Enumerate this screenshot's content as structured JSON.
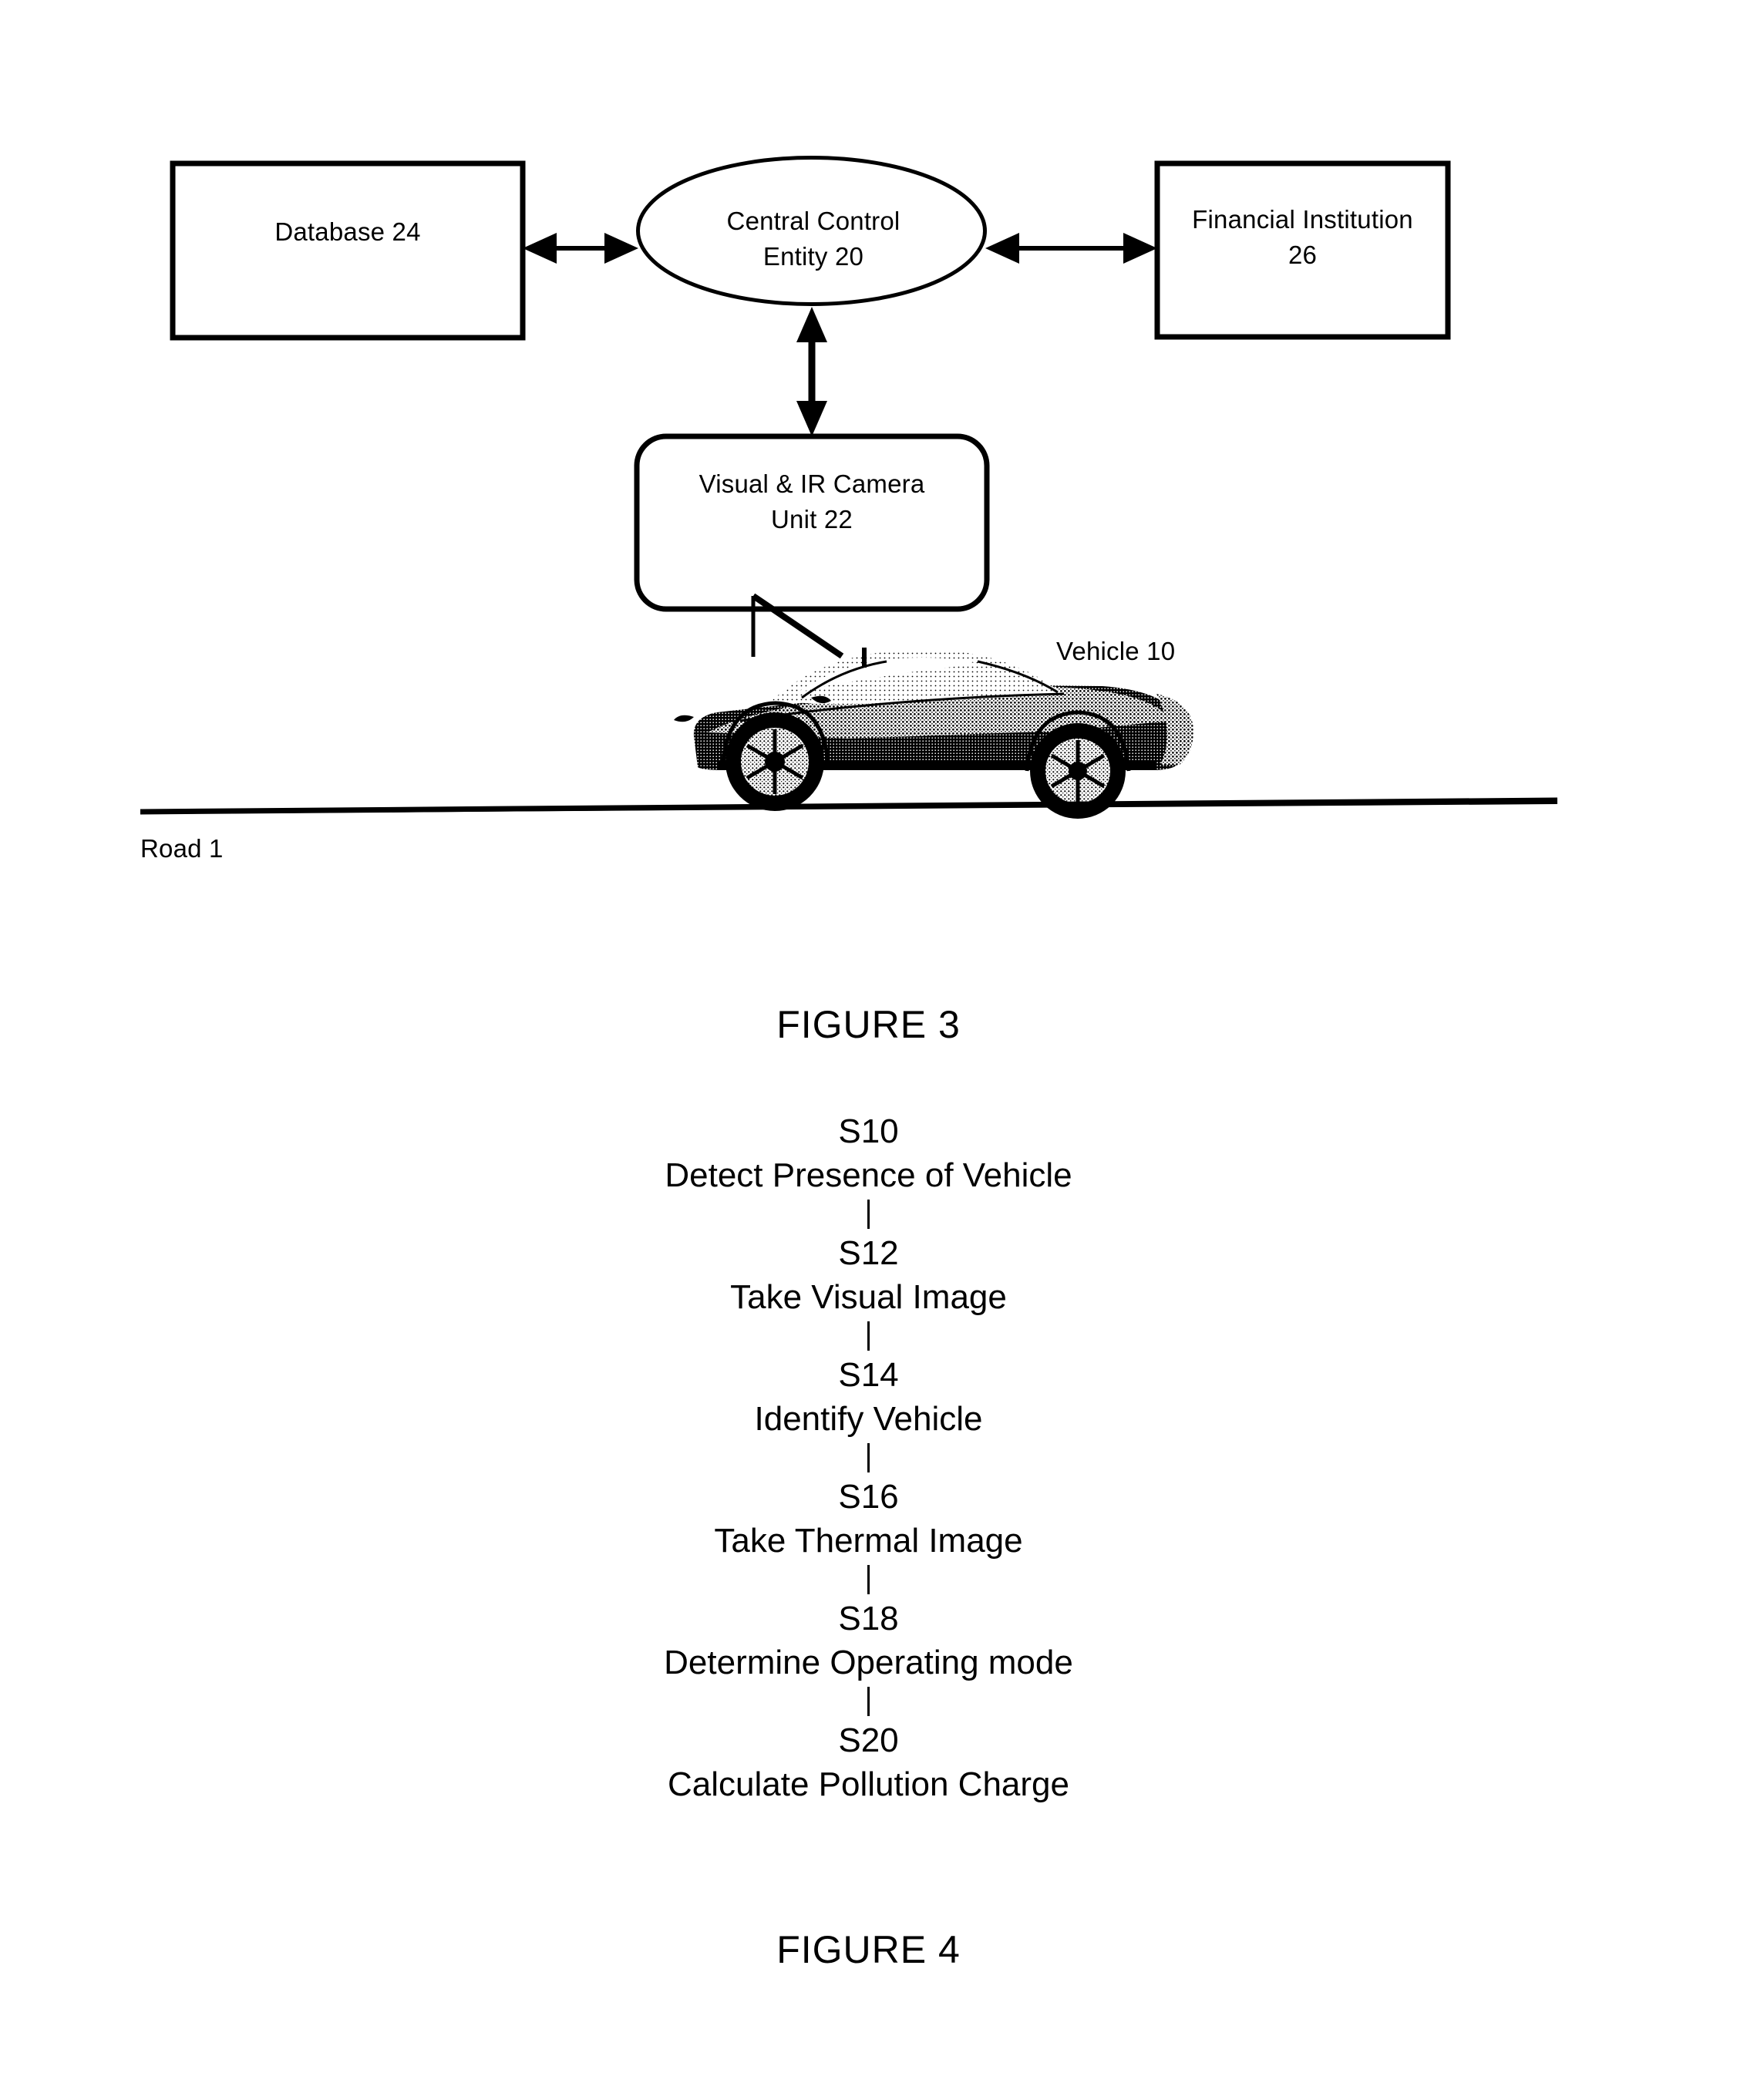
{
  "page": {
    "background_color": "#ffffff",
    "ink_color": "#000000"
  },
  "figure3": {
    "caption": "FIGURE 3",
    "nodes": [
      {
        "id": "database",
        "shape": "rectangle",
        "label": "Database 24"
      },
      {
        "id": "central_control",
        "shape": "ellipse",
        "label": "Central Control\nEntity 20"
      },
      {
        "id": "financial_institution",
        "shape": "rectangle",
        "label": "Financial Institution\n26"
      },
      {
        "id": "camera_unit",
        "shape": "rounded-rectangle",
        "label": "Visual & IR Camera\nUnit 22"
      }
    ],
    "annotations": [
      {
        "id": "vehicle",
        "label": "Vehicle 10"
      },
      {
        "id": "road",
        "label": "Road 1"
      }
    ],
    "connectors": [
      {
        "from": "database",
        "to": "central_control",
        "style": "double-arrow",
        "orientation": "horizontal"
      },
      {
        "from": "central_control",
        "to": "financial_institution",
        "style": "double-arrow",
        "orientation": "horizontal"
      },
      {
        "from": "central_control",
        "to": "camera_unit",
        "style": "double-arrow",
        "orientation": "vertical"
      }
    ],
    "pictorial": {
      "vehicle_description": "dark sports car in side view on a sloping road",
      "road_line": "single sloping line rising left to right"
    }
  },
  "figure4": {
    "caption": "FIGURE 4",
    "steps": [
      {
        "id": "S10",
        "text": "Detect Presence of Vehicle"
      },
      {
        "id": "S12",
        "text": "Take Visual Image"
      },
      {
        "id": "S14",
        "text": "Identify Vehicle"
      },
      {
        "id": "S16",
        "text": "Take Thermal Image"
      },
      {
        "id": "S18",
        "text": "Determine Operating mode"
      },
      {
        "id": "S20",
        "text": "Calculate Pollution Charge"
      }
    ]
  }
}
